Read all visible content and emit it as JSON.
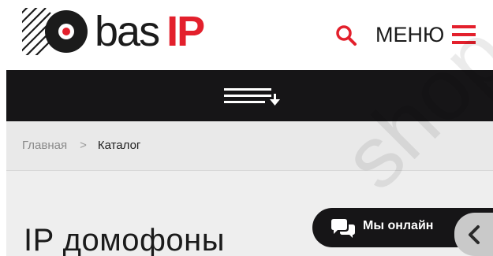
{
  "header": {
    "logo": {
      "text_bas": "bas",
      "text_ip": "IP"
    },
    "search": {
      "icon": "search-icon"
    },
    "menu": {
      "label": "МЕНЮ",
      "icon": "hamburger-icon"
    }
  },
  "nav_bar": {
    "toggle_icon": "list-sort-down-icon"
  },
  "breadcrumb": {
    "home": "Главная",
    "separator": ">",
    "current": "Каталог"
  },
  "page": {
    "title": "IP домофоны"
  },
  "chat": {
    "label": "Мы онлайн",
    "icon": "chat-bubbles-icon"
  },
  "collapse": {
    "icon": "chevron-left-icon"
  },
  "colors": {
    "brand_red": "#e3202c",
    "dark": "#161517",
    "band_gray": "#e9e9e9"
  }
}
